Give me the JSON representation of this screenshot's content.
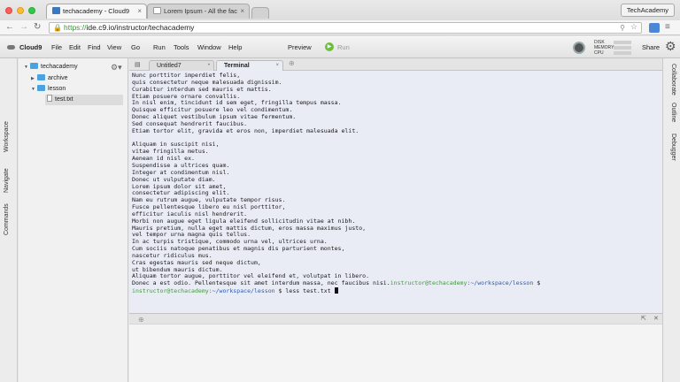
{
  "browser": {
    "tabs": [
      {
        "title": "techacademy - Cloud9",
        "close": "×"
      },
      {
        "title": "Lorem Ipsum - All the fac",
        "close": "×"
      }
    ],
    "profile": "TechAcademy",
    "url_scheme": "https://",
    "url_rest": "ide.c9.io/instructor/techacademy"
  },
  "menubar": {
    "brand": "Cloud9",
    "items": [
      "File",
      "Edit",
      "Find",
      "View",
      "Go",
      "Run",
      "Tools",
      "Window",
      "Help"
    ],
    "preview": "Preview",
    "run": "Run",
    "metrics": [
      "DISK",
      "MEMORY",
      "CPU"
    ],
    "share": "Share"
  },
  "left_panels": [
    "Workspace",
    "Navigate",
    "Commands"
  ],
  "right_panels": [
    "Collaborate",
    "Outline",
    "Debugger"
  ],
  "tree": {
    "root": "techacademy",
    "folders": [
      "archive",
      "lesson"
    ],
    "file": "test.txt"
  },
  "editor_tabs": [
    {
      "label": "Untitled7",
      "close": "•"
    },
    {
      "label": "Terminal",
      "close": "×"
    }
  ],
  "terminal": {
    "lines": [
      "Nunc porttitor imperdiet felis,",
      "quis consectetur neque malesuada dignissim.",
      "Curabitur interdum sed mauris et mattis.",
      "Etiam posuere ornare convallis.",
      "In nisl enim, tincidunt id sem eget, fringilla tempus massa.",
      "Quisque efficitur posuere leo vel condimentum.",
      "Donec aliquet vestibulum ipsum vitae fermentum.",
      "Sed consequat hendrerit faucibus.",
      "Etiam tortor elit, gravida et eros non, imperdiet malesuada elit.",
      "",
      "Aliquam in suscipit nisi,",
      "vitae fringilla metus.",
      "Aenean id nisl ex.",
      "Suspendisse a ultrices quam.",
      "Integer at condimentum nisl.",
      "Donec ut vulputate diam.",
      "Lorem ipsum dolor sit amet,",
      "consectetur adipiscing elit.",
      "Nam eu rutrum augue, vulputate tempor risus.",
      "Fusce pellentesque libero eu nisl porttitor,",
      "efficitur iaculis nisl hendrerit.",
      "Morbi non augue eget ligula eleifend sollicitudin vitae at nibh.",
      "Mauris pretium, nulla eget mattis dictum, eros massa maximus justo,",
      "vel tempor urna magna quis tellus.",
      "In ac turpis tristique, commodo urna vel, ultrices urna.",
      "Cum sociis natoque penatibus et magnis dis parturient montes,",
      "nascetur ridiculus mus.",
      "Cras egestas mauris sed neque dictum,",
      "ut bibendum mauris dictum.",
      "Aliquam tortor augue, porttitor vel eleifend et, volutpat in libero."
    ],
    "last_text": "Donec a est odio. Pellentesque sit amet interdum massa, nec faucibus nisi.",
    "user": "instructor@techacademy",
    "path": ":~/workspace/lesson",
    "suffix_1": " $",
    "suffix_2": " $ less test.txt "
  }
}
